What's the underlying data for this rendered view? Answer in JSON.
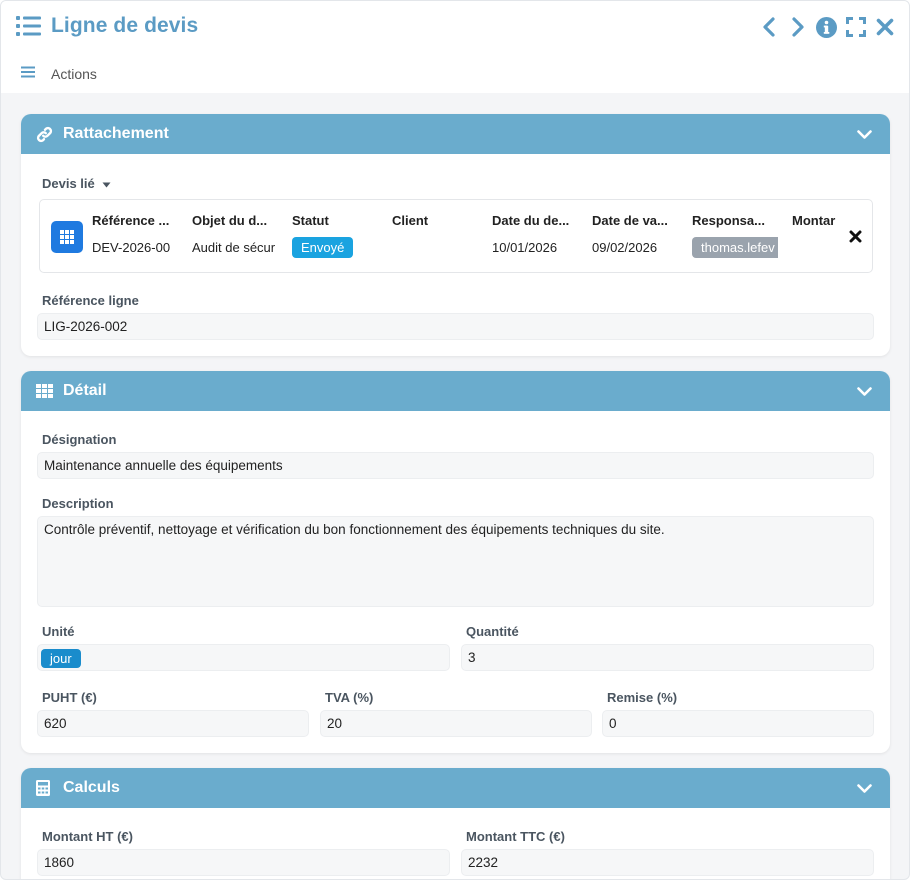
{
  "window": {
    "title": "Ligne de devis",
    "actions_label": "Actions"
  },
  "rattachement": {
    "title": "Rattachement",
    "devis_lie_label": "Devis lié",
    "columns": [
      "Référence ...",
      "Objet du d...",
      "Statut",
      "Client",
      "Date du de...",
      "Date de va...",
      "Responsa...",
      "Montar"
    ],
    "row": {
      "reference": "DEV-2026-00",
      "objet": "Audit de sécur",
      "statut": "Envoyé",
      "client": "",
      "date_devis": "10/01/2026",
      "date_validite": "09/02/2026",
      "responsable": "thomas.lefev",
      "montant": ""
    },
    "reference_ligne_label": "Référence ligne",
    "reference_ligne_value": "LIG-2026-002"
  },
  "detail": {
    "title": "Détail",
    "designation_label": "Désignation",
    "designation_value": "Maintenance annuelle des équipements",
    "description_label": "Description",
    "description_value": "Contrôle préventif, nettoyage et vérification du bon fonctionnement des équipements techniques du site.",
    "unite_label": "Unité",
    "unite_value": "jour",
    "quantite_label": "Quantité",
    "quantite_value": "3",
    "puht_label": "PUHT (€)",
    "puht_value": "620",
    "tva_label": "TVA (%)",
    "tva_value": "20",
    "remise_label": "Remise (%)",
    "remise_value": "0"
  },
  "calculs": {
    "title": "Calculs",
    "montant_ht_label": "Montant HT (€)",
    "montant_ht_value": "1860",
    "montant_ttc_label": "Montant TTC (€)",
    "montant_ttc_value": "2232"
  },
  "colors": {
    "accent": "#5b9bc4",
    "panel_header": "#6aaccd",
    "badge_status": "#1aa3e0",
    "badge_user": "#9aa3ad",
    "unit_chip": "#1a8ccc"
  },
  "icons": {
    "title": "list-icon",
    "prev": "chevron-left-icon",
    "next": "chevron-right-icon",
    "info": "info-icon",
    "fullscreen": "fullscreen-icon",
    "close": "close-icon",
    "menu": "hamburger-icon",
    "rattachement": "link-icon",
    "detail": "table-icon",
    "calculs": "calculator-icon"
  }
}
